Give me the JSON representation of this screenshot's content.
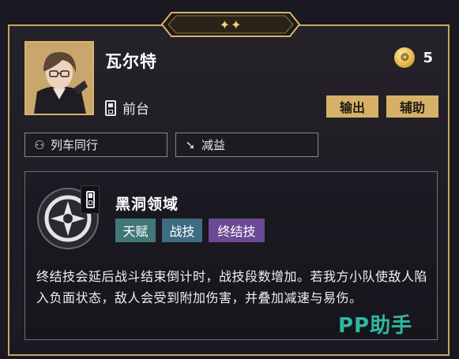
{
  "header": {
    "stars": "✦✦"
  },
  "character": {
    "name": "瓦尔特",
    "path_label": "前台",
    "cost_value": "5",
    "portrait_icon": "character-portrait"
  },
  "roles": {
    "dps_label": "输出",
    "support_label": "辅助"
  },
  "attributes": [
    {
      "icon": "train-icon",
      "glyph": "⚇",
      "label": "列车同行"
    },
    {
      "icon": "debuff-icon",
      "glyph": "➘",
      "label": "减益"
    }
  ],
  "skill": {
    "name": "黑洞领域",
    "tags": {
      "talent": "天赋",
      "skill": "战技",
      "ultimate": "终结技"
    },
    "description": "终结技会延后战斗结束倒计时，战技段数增加。若我方小队使敌人陷入负面状态，敌人会受到附加伤害，并叠加减速与易伤。"
  },
  "watermark": "PP助手",
  "colors": {
    "gold_border": "#c9a561",
    "role_button": "#d7b068",
    "tag_talent": "#3f7876",
    "tag_skill": "#3d6c83",
    "tag_ultimate": "#6b4a95",
    "watermark": "#2fb7a0"
  }
}
